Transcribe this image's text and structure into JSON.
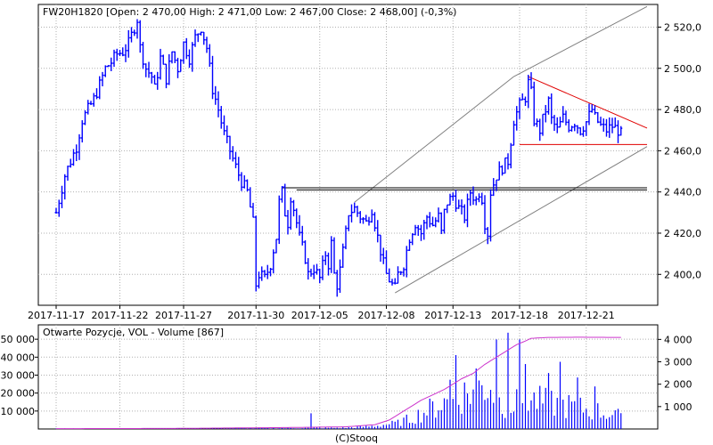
{
  "footer": {
    "copyright": "(C)Stooq"
  },
  "chart_data": [
    {
      "type": "candlestick",
      "header": "FW20H1820 [Open: 2 470,00  High: 2 471,00  Low: 2 467,00  Close: 2 468,00] (-0,3%)",
      "ticker": "FW20H1820",
      "last": {
        "open": 2470,
        "high": 2471,
        "low": 2467,
        "close": 2468,
        "change_pct": -0.3
      },
      "x_labels": [
        "2017-11-17",
        "2017-11-22",
        "2017-11-27",
        "2017-11-30",
        "2017-12-05",
        "2017-12-08",
        "2017-12-13",
        "2017-12-18",
        "2017-12-21"
      ],
      "y_ticks": [
        2400,
        2420,
        2440,
        2460,
        2480,
        2500,
        2520
      ],
      "y_tick_labels": [
        "2 400,0",
        "2 420,0",
        "2 440,0",
        "2 460,0",
        "2 480,0",
        "2 500,0",
        "2 520,0"
      ],
      "ylim": [
        2385,
        2531
      ],
      "axis_side": "right",
      "grid": true,
      "bar_color": "#0000ff",
      "anchors": [
        [
          0,
          2430
        ],
        [
          3,
          2448
        ],
        [
          5,
          2455
        ],
        [
          7,
          2462
        ],
        [
          9,
          2475
        ],
        [
          11,
          2480
        ],
        [
          13,
          2485
        ],
        [
          15,
          2492
        ],
        [
          17,
          2500
        ],
        [
          19,
          2503
        ],
        [
          21,
          2507
        ],
        [
          23,
          2508
        ],
        [
          25,
          2512
        ],
        [
          27,
          2520
        ],
        [
          28,
          2524
        ],
        [
          29,
          2510
        ],
        [
          31,
          2500
        ],
        [
          33,
          2496
        ],
        [
          34,
          2490
        ],
        [
          36,
          2505
        ],
        [
          38,
          2495
        ],
        [
          40,
          2508
        ],
        [
          42,
          2500
        ],
        [
          44,
          2512
        ],
        [
          46,
          2505
        ],
        [
          48,
          2515
        ],
        [
          50,
          2520
        ],
        [
          52,
          2510
        ],
        [
          54,
          2490
        ],
        [
          56,
          2480
        ],
        [
          58,
          2468
        ],
        [
          60,
          2460
        ],
        [
          62,
          2452
        ],
        [
          64,
          2445
        ],
        [
          66,
          2440
        ],
        [
          68,
          2425
        ],
        [
          69,
          2395
        ],
        [
          70,
          2400
        ],
        [
          72,
          2398
        ],
        [
          74,
          2405
        ],
        [
          75,
          2412
        ],
        [
          76,
          2418
        ],
        [
          77,
          2435
        ],
        [
          78,
          2440
        ],
        [
          79,
          2430
        ],
        [
          80,
          2425
        ],
        [
          81,
          2438
        ],
        [
          82,
          2432
        ],
        [
          84,
          2418
        ],
        [
          86,
          2408
        ],
        [
          87,
          2400
        ],
        [
          89,
          2403
        ],
        [
          91,
          2398
        ],
        [
          93,
          2410
        ],
        [
          94,
          2405
        ],
        [
          95,
          2415
        ],
        [
          96,
          2400
        ],
        [
          97,
          2395
        ],
        [
          98,
          2402
        ],
        [
          100,
          2420
        ],
        [
          101,
          2430
        ],
        [
          103,
          2432
        ],
        [
          105,
          2428
        ],
        [
          107,
          2425
        ],
        [
          109,
          2432
        ],
        [
          111,
          2418
        ],
        [
          113,
          2405
        ],
        [
          114,
          2400
        ],
        [
          116,
          2395
        ],
        [
          117,
          2393
        ],
        [
          118,
          2400
        ],
        [
          120,
          2405
        ],
        [
          122,
          2418
        ],
        [
          124,
          2425
        ],
        [
          126,
          2420
        ],
        [
          128,
          2428
        ],
        [
          130,
          2424
        ],
        [
          132,
          2428
        ],
        [
          133,
          2420
        ],
        [
          134,
          2430
        ],
        [
          135,
          2435
        ],
        [
          137,
          2438
        ],
        [
          139,
          2432
        ],
        [
          141,
          2428
        ],
        [
          143,
          2440
        ],
        [
          145,
          2436
        ],
        [
          146,
          2440
        ],
        [
          147,
          2437
        ],
        [
          148,
          2425
        ],
        [
          149,
          2420
        ],
        [
          150,
          2440
        ],
        [
          152,
          2448
        ],
        [
          154,
          2452
        ],
        [
          156,
          2455
        ],
        [
          157,
          2465
        ],
        [
          158,
          2475
        ],
        [
          160,
          2482
        ],
        [
          162,
          2486
        ],
        [
          163,
          2493
        ],
        [
          164,
          2488
        ],
        [
          165,
          2475
        ],
        [
          167,
          2470
        ],
        [
          169,
          2480
        ],
        [
          170,
          2484
        ],
        [
          171,
          2475
        ],
        [
          173,
          2470
        ],
        [
          175,
          2476
        ],
        [
          177,
          2472
        ],
        [
          179,
          2474
        ],
        [
          181,
          2470
        ],
        [
          183,
          2474
        ],
        [
          185,
          2480
        ],
        [
          186,
          2476
        ],
        [
          188,
          2472
        ],
        [
          190,
          2470
        ],
        [
          192,
          2472
        ],
        [
          194,
          2470
        ],
        [
          195,
          2468
        ]
      ],
      "upper_channel": [
        [
          103,
          2435
        ],
        [
          158,
          2496
        ]
      ],
      "upper_channel_ext": [
        [
          158,
          2496
        ],
        [
          204,
          2530
        ]
      ],
      "lower_channel": [
        [
          117,
          2391
        ],
        [
          204,
          2462
        ]
      ],
      "resistance_lines": [
        {
          "from": [
            78,
            2442
          ],
          "to": [
            204,
            2442
          ]
        },
        {
          "from": [
            83,
            2441
          ],
          "to": [
            204,
            2441
          ]
        }
      ],
      "triangle_top": [
        [
          163,
          2496
        ],
        [
          204,
          2471
        ]
      ],
      "triangle_bottom": [
        [
          160,
          2463
        ],
        [
          204,
          2463
        ]
      ],
      "trend_color": "#808080",
      "triangle_color": "#e00000"
    },
    {
      "type": "bar",
      "header": "Otwarte Pozycje, VOL - Volume [867]",
      "left_ticks": [
        10000,
        20000,
        30000,
        40000,
        50000
      ],
      "left_tick_labels": [
        "10 000",
        "20 000",
        "30 000",
        "40 000",
        "50 000"
      ],
      "left_ylim": [
        0,
        58000
      ],
      "right_ticks": [
        1000,
        2000,
        3000,
        4000
      ],
      "right_tick_labels": [
        "1 000",
        "2 000",
        "3 000",
        "4 000"
      ],
      "right_ylim": [
        0,
        4650
      ],
      "volume_anchors": [
        [
          0,
          20
        ],
        [
          60,
          30
        ],
        [
          100,
          60
        ],
        [
          110,
          150
        ],
        [
          118,
          300
        ],
        [
          122,
          500
        ],
        [
          128,
          900
        ],
        [
          135,
          1400
        ],
        [
          140,
          1700
        ],
        [
          145,
          1900
        ],
        [
          150,
          2300
        ],
        [
          152,
          1400
        ],
        [
          158,
          1200
        ],
        [
          163,
          1500
        ],
        [
          168,
          1300
        ],
        [
          175,
          1200
        ],
        [
          182,
          1000
        ],
        [
          190,
          800
        ],
        [
          195,
          500
        ]
      ],
      "volume_spikes": [
        [
          88,
          700
        ],
        [
          136,
          2200
        ],
        [
          138,
          3300
        ],
        [
          145,
          2700
        ],
        [
          152,
          4000
        ],
        [
          156,
          4300
        ],
        [
          160,
          4000
        ],
        [
          162,
          2900
        ],
        [
          170,
          2500
        ],
        [
          174,
          3000
        ],
        [
          180,
          2300
        ],
        [
          186,
          1900
        ],
        [
          194,
          900
        ]
      ],
      "volume_color": "#0000ff",
      "open_interest_color": "#cc33cc",
      "open_interest": [
        [
          0,
          200
        ],
        [
          40,
          300
        ],
        [
          80,
          800
        ],
        [
          100,
          1200
        ],
        [
          110,
          2400
        ],
        [
          115,
          5000
        ],
        [
          118,
          8000
        ],
        [
          122,
          12000
        ],
        [
          126,
          16000
        ],
        [
          130,
          19000
        ],
        [
          134,
          22000
        ],
        [
          140,
          28000
        ],
        [
          144,
          31000
        ],
        [
          148,
          36000
        ],
        [
          152,
          40000
        ],
        [
          156,
          44000
        ],
        [
          159,
          47000
        ],
        [
          162,
          49000
        ],
        [
          164,
          50500
        ],
        [
          170,
          51000
        ],
        [
          180,
          51100
        ],
        [
          195,
          51000
        ]
      ]
    }
  ]
}
